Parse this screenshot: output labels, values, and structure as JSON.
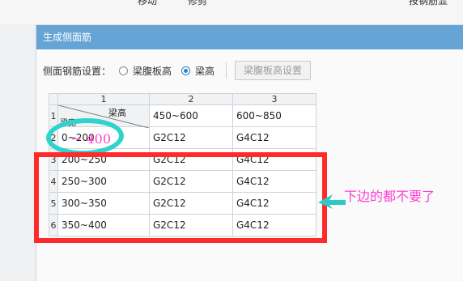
{
  "window": {
    "title": "生成侧面筋"
  },
  "background_toolbar": {
    "items": [
      "移动",
      "修剪",
      "按钢筋显"
    ]
  },
  "settings": {
    "label": "侧面钢筋设置：",
    "options": [
      {
        "label": "梁腹板高",
        "selected": false
      },
      {
        "label": "梁高",
        "selected": true
      }
    ],
    "button_label": "梁腹板高设置"
  },
  "grid": {
    "column_headers": [
      "1",
      "2",
      "3"
    ],
    "corner_header": {
      "top_right": "梁高",
      "bottom_left": "梁宽"
    },
    "header_row": {
      "row_number": "1",
      "col2": "450~600",
      "col3": "600~850"
    },
    "rows": [
      {
        "row_number": "2",
        "range": "0~200",
        "col2": "G2C12",
        "col3": "G4C12"
      },
      {
        "row_number": "3",
        "range": "200~250",
        "col2": "G2C12",
        "col3": "G4C12"
      },
      {
        "row_number": "4",
        "range": "250~300",
        "col2": "G2C12",
        "col3": "G4C12"
      },
      {
        "row_number": "5",
        "range": "300~350",
        "col2": "G2C12",
        "col3": "G4C12"
      },
      {
        "row_number": "6",
        "range": "350~400",
        "col2": "G2C12",
        "col3": "G4C12"
      }
    ]
  },
  "annotations": {
    "ellipse_text": "~ 400",
    "note_text": "下边的都不要了",
    "colors": {
      "ellipse": "#2fd3cc",
      "box": "#ff2b2b",
      "text": "#ff3fd2",
      "arrow": "#2fc9c3"
    }
  }
}
